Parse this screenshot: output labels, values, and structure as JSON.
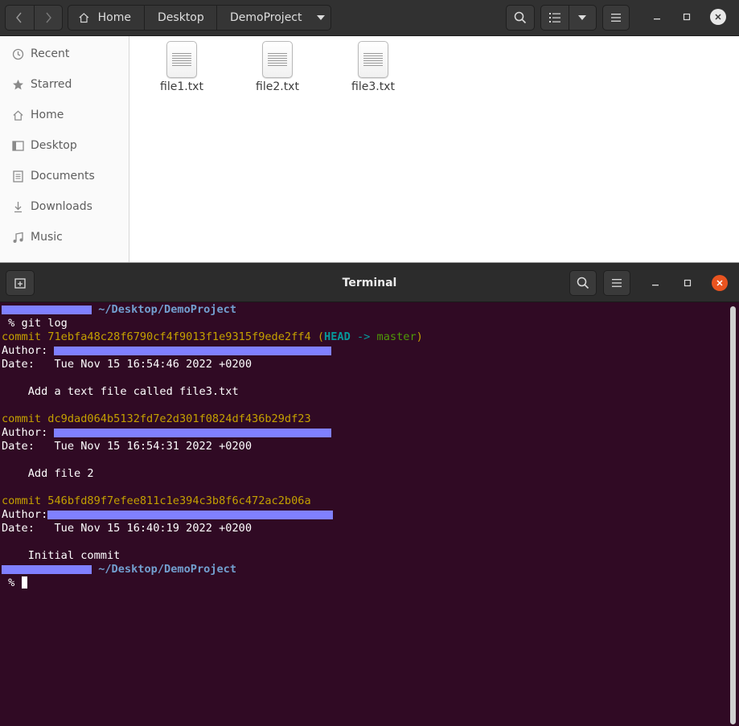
{
  "files_window": {
    "path": {
      "home": "Home",
      "desktop": "Desktop",
      "current": "DemoProject"
    },
    "sidebar": [
      {
        "label": "Recent",
        "icon": "recent-icon"
      },
      {
        "label": "Starred",
        "icon": "star-icon"
      },
      {
        "label": "Home",
        "icon": "home-icon"
      },
      {
        "label": "Desktop",
        "icon": "desktop-icon"
      },
      {
        "label": "Documents",
        "icon": "document-icon"
      },
      {
        "label": "Downloads",
        "icon": "download-icon"
      },
      {
        "label": "Music",
        "icon": "music-icon"
      }
    ],
    "files": [
      {
        "name": "file1.txt"
      },
      {
        "name": "file2.txt"
      },
      {
        "name": "file3.txt"
      }
    ]
  },
  "terminal": {
    "title": "Terminal",
    "prompt_path": "~/Desktop/DemoProject",
    "command": " % git log",
    "commits": [
      {
        "label": "commit",
        "hash": "71ebfa48c28f6790cf4f9013f1e9315f9ede2ff4",
        "ref_open": "(",
        "head": "HEAD",
        "arrow": " -> ",
        "branch": "master",
        "ref_close": ")",
        "author_label": "Author:",
        "date_label": "Date:",
        "date": "Tue Nov 15 16:54:46 2022 +0200",
        "message": "Add a text file called file3.txt"
      },
      {
        "label": "commit",
        "hash": "dc9dad064b5132fd7e2d301f0824df436b29df23",
        "author_label": "Author:",
        "date_label": "Date:",
        "date": "Tue Nov 15 16:54:31 2022 +0200",
        "message": "Add file 2"
      },
      {
        "label": "commit",
        "hash": "546bfd89f7efee811c1e394c3b8f6c472ac2b06a",
        "author_label": "Author:",
        "date_label": "Date:",
        "date": "Tue Nov 15 16:40:19 2022 +0200",
        "message": "Initial commit"
      }
    ],
    "final_prompt": " %",
    "colors": {
      "background": "#300a24",
      "commit": "#c4a000",
      "head": "#06989a",
      "branch": "#4e9a06",
      "path": "#729fcf",
      "redaction": "#8080ff"
    }
  }
}
